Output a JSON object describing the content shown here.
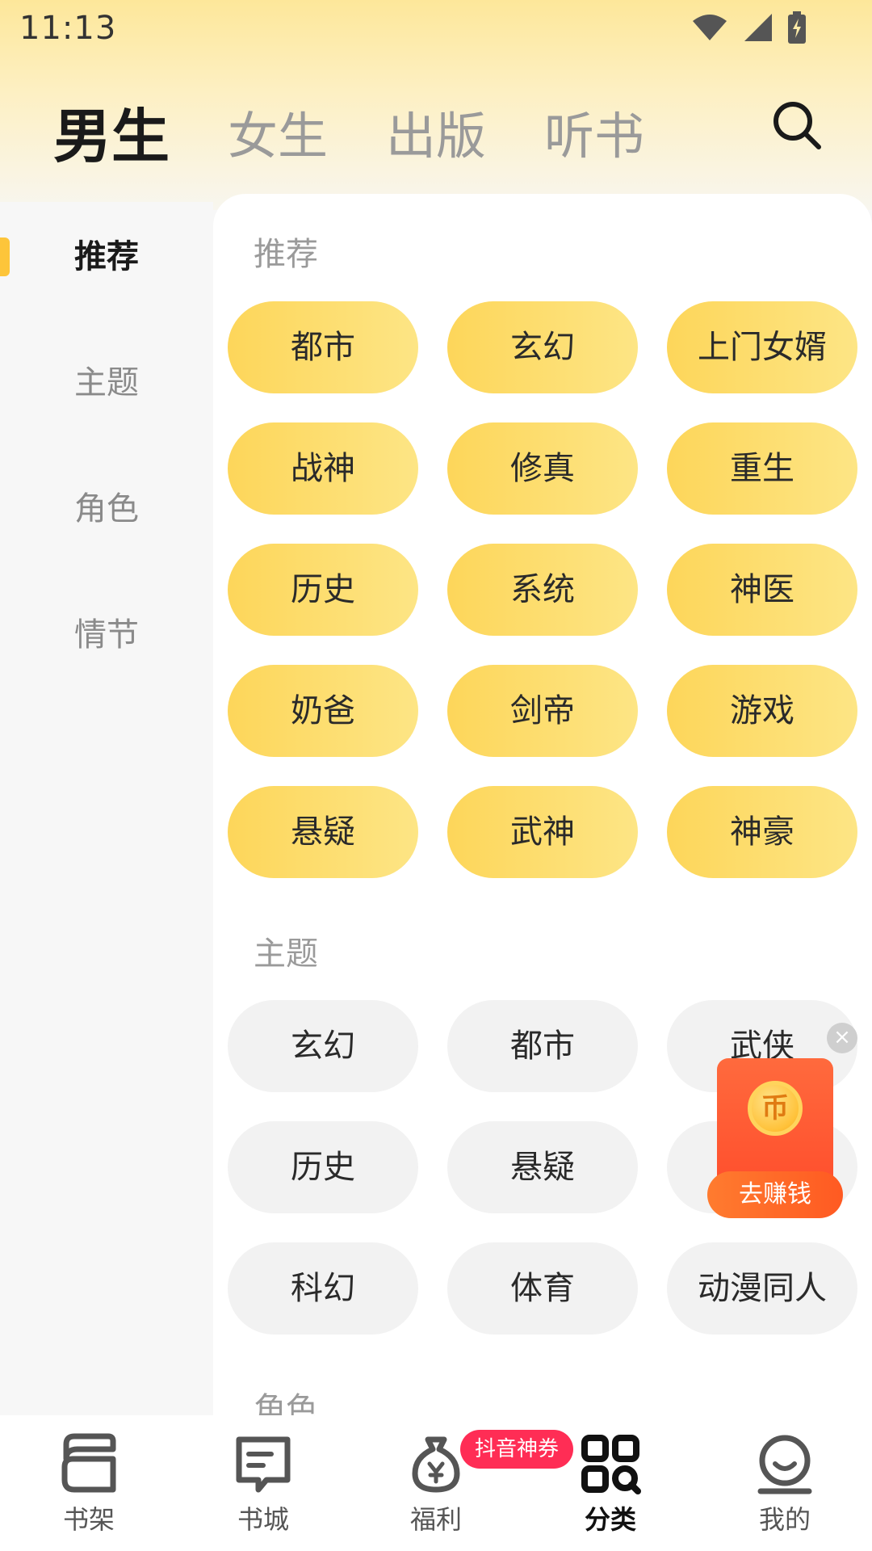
{
  "status_bar": {
    "time": "11:13"
  },
  "top_tabs": [
    {
      "label": "男生"
    },
    {
      "label": "女生"
    },
    {
      "label": "出版"
    },
    {
      "label": "听书"
    }
  ],
  "sidebar": {
    "items": [
      {
        "label": "推荐"
      },
      {
        "label": "主题"
      },
      {
        "label": "角色"
      },
      {
        "label": "情节"
      }
    ]
  },
  "sections": {
    "recommend": {
      "title": "推荐",
      "tags": [
        "都市",
        "玄幻",
        "上门女婿",
        "战神",
        "修真",
        "重生",
        "历史",
        "系统",
        "神医",
        "奶爸",
        "剑帝",
        "游戏",
        "悬疑",
        "武神",
        "神豪"
      ]
    },
    "theme": {
      "title": "主题",
      "tags": [
        "玄幻",
        "都市",
        "武侠",
        "历史",
        "悬疑",
        "科幻",
        "体育",
        "动漫同人"
      ]
    },
    "role": {
      "title": "角色"
    }
  },
  "float_ad": {
    "coin_symbol": "币",
    "cta": "去赚钱",
    "close": "×"
  },
  "bottom_nav": {
    "items": [
      {
        "label": "书架"
      },
      {
        "label": "书城"
      },
      {
        "label": "福利",
        "badge": "抖音神券"
      },
      {
        "label": "分类"
      },
      {
        "label": "我的"
      }
    ]
  },
  "colors": {
    "accent": "#fdc53a",
    "chip_yellow": "#fdd65a",
    "chip_gray": "#f2f2f2",
    "badge_red": "#ff2d55"
  }
}
